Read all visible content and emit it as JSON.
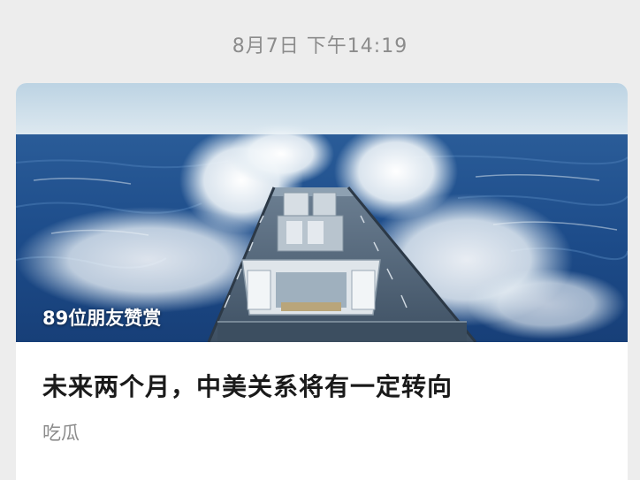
{
  "timestamp": "8月7日 下午14:19",
  "article": {
    "appreciation_text": "89位朋友赞赏",
    "title": "未来两个月，中美关系将有一定转向",
    "account_name": "吃瓜"
  },
  "colors": {
    "background": "#ededed",
    "card": "#ffffff",
    "muted_text": "#8c8c8c",
    "title_text": "#1a1a1a",
    "sea": "#1f4f8f",
    "sky": "#c9dbe8"
  }
}
